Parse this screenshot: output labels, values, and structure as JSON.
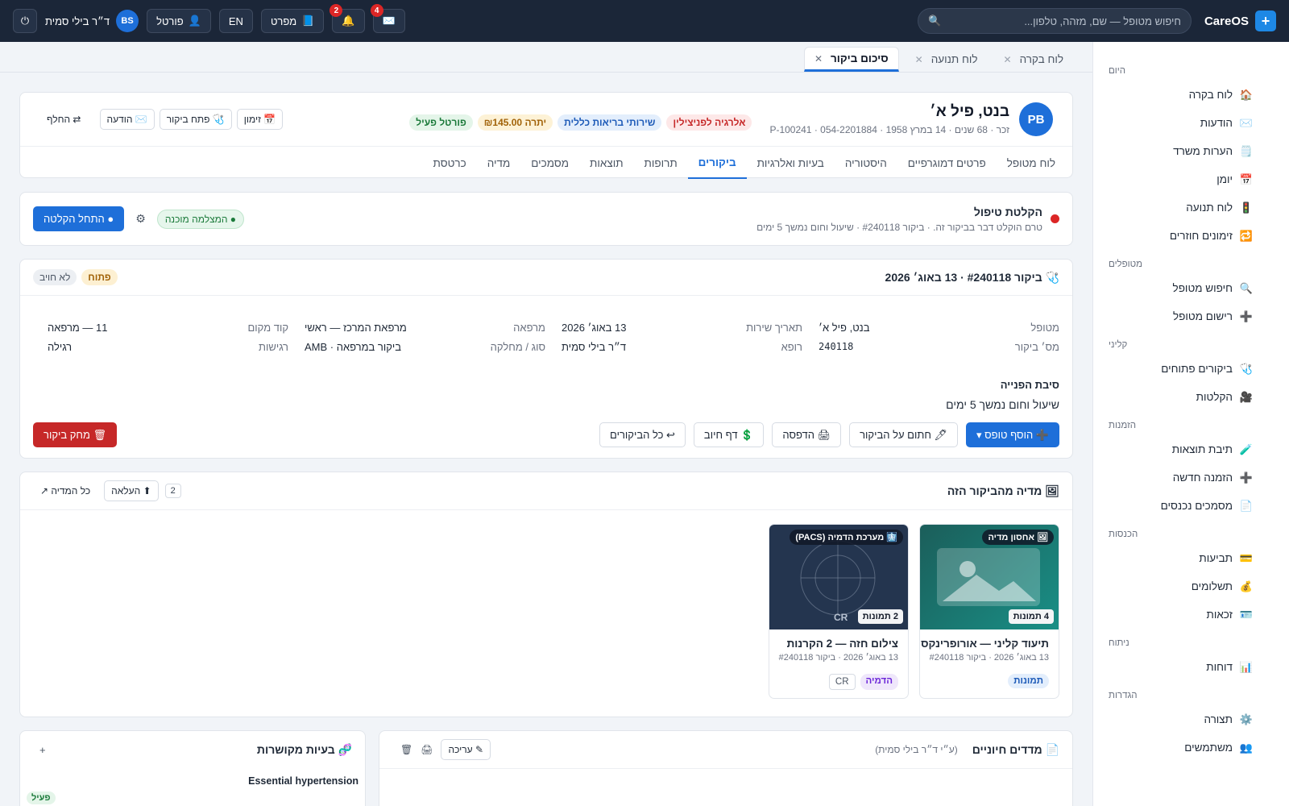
{
  "topbar": {
    "brand": "CareOS",
    "brand_logo": "+",
    "search_placeholder": "חיפוש מטופל — שם, מזהה, טלפון...",
    "mail_count": "4",
    "bell_count": "2",
    "manual_label": "מפרט",
    "lang_label": "EN",
    "portal_label": "פורטל",
    "user_initials": "BS",
    "user_name": "ד״ר בילי סמית"
  },
  "sidebar": {
    "sections": [
      {
        "title": "היום",
        "items": [
          {
            "icon": "🏠",
            "icon_name": "home-icon",
            "label": "לוח בקרה"
          },
          {
            "icon": "✉️",
            "icon_name": "mail-icon",
            "label": "הודעות"
          },
          {
            "icon": "🗒️",
            "icon_name": "notes-icon",
            "label": "הערות משרד"
          },
          {
            "icon": "📅",
            "icon_name": "calendar-icon",
            "label": "יומן"
          },
          {
            "icon": "🚦",
            "icon_name": "traffic-light-icon",
            "label": "לוח תנועה"
          },
          {
            "icon": "🔁",
            "icon_name": "repeat-icon",
            "label": "זימונים חוזרים"
          }
        ]
      },
      {
        "title": "מטופלים",
        "items": [
          {
            "icon": "🔍",
            "icon_name": "search-icon",
            "label": "חיפוש מטופל"
          },
          {
            "icon": "➕",
            "icon_name": "plus-icon",
            "label": "רישום מטופל"
          }
        ]
      },
      {
        "title": "קליני",
        "items": [
          {
            "icon": "🩺",
            "icon_name": "stethoscope-icon",
            "label": "ביקורים פתוחים"
          },
          {
            "icon": "🎥",
            "icon_name": "video-icon",
            "label": "הקלטות"
          }
        ]
      },
      {
        "title": "הזמנות",
        "items": [
          {
            "icon": "🧪",
            "icon_name": "test-tube-icon",
            "label": "תיבת תוצאות"
          },
          {
            "icon": "➕",
            "icon_name": "plus-icon",
            "label": "הזמנה חדשה"
          },
          {
            "icon": "📄",
            "icon_name": "document-icon",
            "label": "מסמכים נכנסים"
          }
        ]
      },
      {
        "title": "הכנסות",
        "items": [
          {
            "icon": "💳",
            "icon_name": "credit-card-icon",
            "label": "תביעות"
          },
          {
            "icon": "💰",
            "icon_name": "money-bag-icon",
            "label": "תשלומים"
          },
          {
            "icon": "🪪",
            "icon_name": "id-card-icon",
            "label": "זכאות"
          }
        ]
      },
      {
        "title": "ניתוח",
        "items": [
          {
            "icon": "📊",
            "icon_name": "chart-icon",
            "label": "דוחות"
          }
        ]
      },
      {
        "title": "הגדרות",
        "items": [
          {
            "icon": "⚙️",
            "icon_name": "gear-icon",
            "label": "תצורה"
          },
          {
            "icon": "👥",
            "icon_name": "users-icon",
            "label": "משתמשים"
          }
        ]
      }
    ]
  },
  "page_tabs": [
    {
      "label": "לוח בקרה",
      "active": false
    },
    {
      "label": "לוח תנועה",
      "active": false
    },
    {
      "label": "סיכום ביקור",
      "active": true
    }
  ],
  "patient": {
    "initials": "PB",
    "name": "בנט, פיל א׳",
    "meta": "זכר · 68 שנים · 14 במרץ 1958 · P-100241 · 054-2201884",
    "chips": [
      {
        "label": "אלרגיה לפניצילין",
        "tone": "red"
      },
      {
        "label": "שירותי בריאות כללית",
        "tone": "blue"
      },
      {
        "label": "יתרה ₪145.00",
        "tone": "amber"
      },
      {
        "label": "פורטל פעיל",
        "tone": "green"
      }
    ],
    "actions": {
      "schedule": "📅 זימון",
      "open_visit": "🩺 פתח ביקור",
      "message": "✉️ הודעה",
      "switch": "⇄ החלף"
    },
    "nav_tabs": [
      "לוח מטופל",
      "פרטים דמוגרפיים",
      "היסטוריה",
      "בעיות ואלרגיות",
      "ביקורים",
      "תרופות",
      "תוצאות",
      "מסמכים",
      "מדיה",
      "כרטסת"
    ],
    "active_nav": "ביקורים"
  },
  "recording": {
    "title": "הקלטת טיפול",
    "subtitle": "טרם הוקלט דבר בביקור זה. · ביקור #240118 · שיעול וחום נמשך 5 ימים",
    "status": "● המצלמה מוכנה",
    "start_label": "● התחל הקלטה"
  },
  "visit": {
    "title": "🩺 ביקור #240118 · 13 באוג׳ 2026",
    "status_badge": "פתוח",
    "billing_badge": "לא חויב",
    "fields": [
      [
        {
          "label": "מטופל",
          "value": "בנט, פיל א׳"
        },
        {
          "label": "תאריך שירות",
          "value": "13 באוג׳ 2026"
        },
        {
          "label": "מרפאה",
          "value": "מרפאת המרכז — ראשי"
        },
        {
          "label": "קוד מקום",
          "value": "11 — מרפאה"
        }
      ],
      [
        {
          "label": "מס׳ ביקור",
          "value": "240118"
        },
        {
          "label": "רופא",
          "value": "ד״ר בילי סמית"
        },
        {
          "label": "סוג / מחלקה",
          "value": "ביקור במרפאה · AMB"
        },
        {
          "label": "רגישות",
          "value": "רגילה"
        }
      ]
    ],
    "reason_label": "סיבת הפנייה",
    "reason_value": "שיעול וחום נמשך 5 ימים",
    "actions": {
      "add_form": "➕ הוסף טופס ▾",
      "sign": "🖊 חתום על הביקור",
      "print": "🖨 הדפסה",
      "billing": "💲 דף חיוב",
      "all_visits": "↩ כל הביקורים",
      "delete": "🗑 מחק ביקור"
    }
  },
  "media": {
    "title": "🖼 מדיה מהביקור הזה",
    "count": "2",
    "upload_label": "⬆ העלאה",
    "all_label": "כל המדיה ↗",
    "items": [
      {
        "source": "🖼 אחסון מדיה",
        "count_label": "4 תמונות",
        "title": "תיעוד קליני — אורופרינקס",
        "subtitle": "13 באוג׳ 2026 · ביקור #240118",
        "chips": [
          "תמונות"
        ]
      },
      {
        "source": "🩻 מערכת הדמיה (PACS)",
        "count_label": "2 תמונות",
        "title": "צילום חזה — 2 הקרנות",
        "subtitle": "13 באוג׳ 2026 · ביקור #240118",
        "modality": "CR",
        "chips": [
          "הדמיה",
          "CR"
        ]
      }
    ]
  },
  "vitals": {
    "title": "📄 מדדים חיוניים",
    "by": "(ע״י ד״ר בילי סמית)",
    "edit_label": "✎ עריכה"
  },
  "related": {
    "title": "🧬 בעיות מקושרות",
    "add": "+",
    "problem": "Essential hypertension",
    "status": "פעיל"
  }
}
